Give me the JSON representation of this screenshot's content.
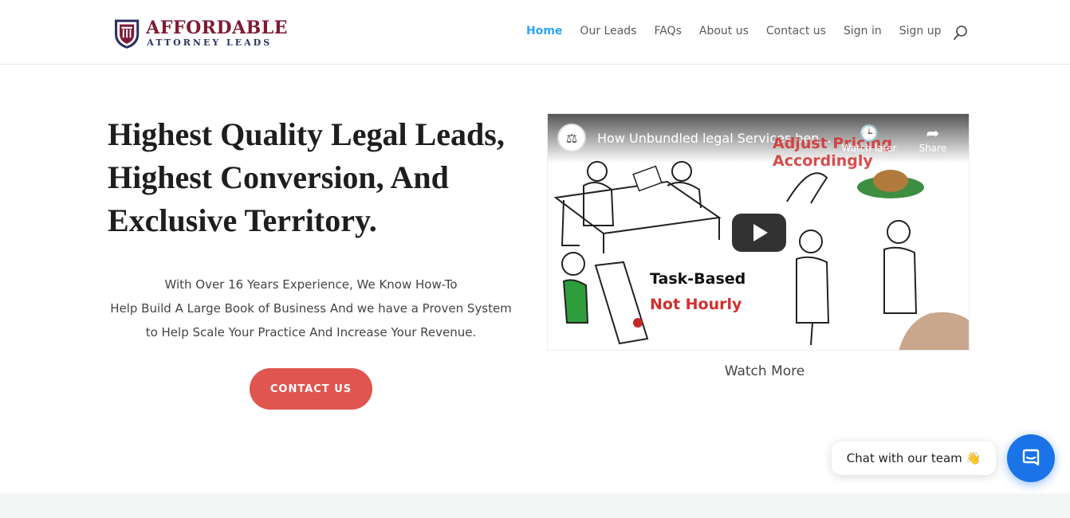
{
  "logo": {
    "line1": "AFFORDABLE",
    "line2": "ATTORNEY LEADS",
    "brand_color": "#7d1a36",
    "accent_color": "#2c2f5f"
  },
  "nav": {
    "items": [
      {
        "label": "Home",
        "active": true
      },
      {
        "label": "Our Leads",
        "active": false
      },
      {
        "label": "FAQs",
        "active": false
      },
      {
        "label": "About us",
        "active": false
      },
      {
        "label": "Contact us",
        "active": false
      },
      {
        "label": "Sign in",
        "active": false
      },
      {
        "label": "Sign up",
        "active": false
      }
    ],
    "active_color": "#2ea3f2",
    "search_icon": "search-icon"
  },
  "hero": {
    "title_lines": [
      "Highest Quality Legal Leads,",
      "Highest Conversion, And",
      "Exclusive Territory."
    ],
    "subtitle_lines": [
      "With Over 16 Years Experience, We Know How-To",
      "Help Build A Large Book of Business And we have a Proven System",
      "to Help Scale Your Practice And Increase Your Revenue."
    ],
    "cta_label": "CONTACT US",
    "cta_color": "#e0554f"
  },
  "video": {
    "title": "How Unbundled legal Services ben...",
    "watch_later_label": "Watch later",
    "share_label": "Share",
    "overlay_task": "Task-Based",
    "overlay_not_hourly": "Not Hourly",
    "overlay_adjust": "Adjust Pricing Accordingly",
    "watch_more_label": "Watch More"
  },
  "chat": {
    "bubble_text": "Chat with our team 👋",
    "launcher_color": "#1b73e8"
  }
}
